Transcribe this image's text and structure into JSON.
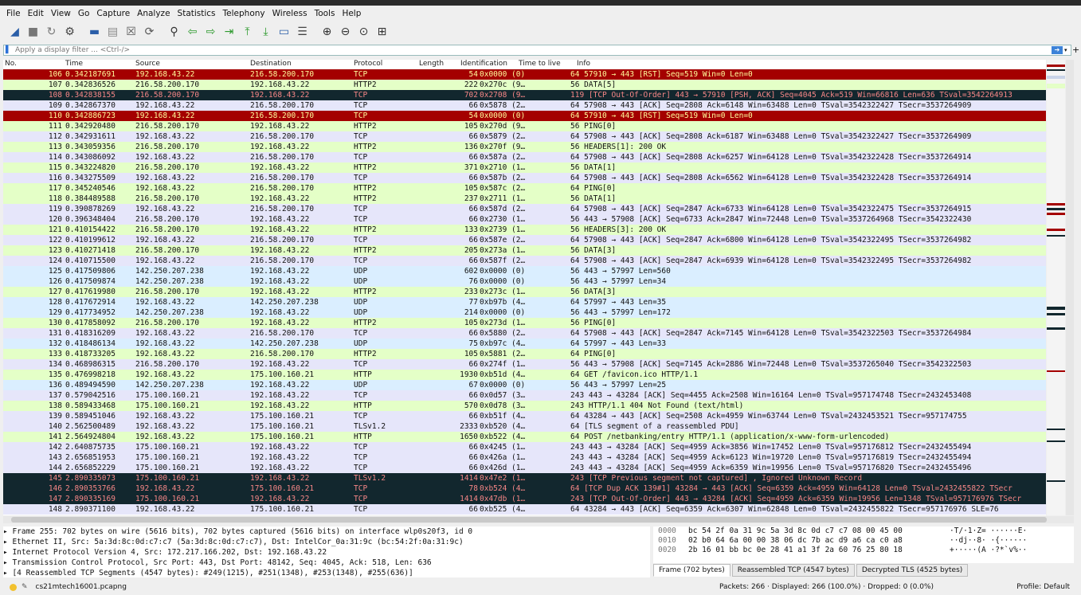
{
  "menu": [
    "File",
    "Edit",
    "View",
    "Go",
    "Capture",
    "Analyze",
    "Statistics",
    "Telephony",
    "Wireless",
    "Tools",
    "Help"
  ],
  "toolbar_icons": [
    "shark-fin-start-icon",
    "stop-icon",
    "restart-icon",
    "options-icon",
    "open-icon",
    "save-icon",
    "close-file-icon",
    "reload-icon",
    "find-icon",
    "back-icon",
    "forward-icon",
    "go-to-packet-icon",
    "first-packet-icon",
    "last-packet-icon",
    "autoscroll-icon",
    "colorize-icon",
    "zoom-in-icon",
    "zoom-out-icon",
    "normal-size-icon",
    "resize-columns-icon"
  ],
  "filter": {
    "placeholder": "Apply a display filter ... <Ctrl-/>"
  },
  "columns": [
    "No.",
    "Time",
    "Source",
    "Destination",
    "Protocol",
    "Length",
    "Identification",
    "Time to live",
    "Info"
  ],
  "colors": {
    "tcp": "#e6e6fa",
    "http": "#e4ffc7",
    "udp": "#daeeff",
    "rst": "#a40000",
    "bad": "#12272e",
    "selected": "#1f4f8f"
  },
  "packets": [
    {
      "no": "106",
      "time": "0.342187691",
      "src": "192.168.43.22",
      "dst": "216.58.200.170",
      "proto": "TCP",
      "len": "54",
      "id": "0x0000 (0)",
      "ttl": "",
      "info": "64 57910 → 443 [RST] Seq=519 Win=0 Len=0",
      "cls": "rst"
    },
    {
      "no": "107",
      "time": "0.342836526",
      "src": "216.58.200.170",
      "dst": "192.168.43.22",
      "proto": "HTTP2",
      "len": "222",
      "id": "0x270c (9…",
      "ttl": "",
      "info": "56 DATA[5]",
      "cls": "http"
    },
    {
      "no": "108",
      "time": "0.342838155",
      "src": "216.58.200.170",
      "dst": "192.168.43.22",
      "proto": "TCP",
      "len": "702",
      "id": "0x2708 (9…",
      "ttl": "",
      "info": "119 [TCP Out-Of-Order] 443 → 57910 [PSH, ACK] Seq=4045 Ack=519 Win=66816 Len=636 TSval=3542264913",
      "cls": "bad"
    },
    {
      "no": "109",
      "time": "0.342867370",
      "src": "192.168.43.22",
      "dst": "216.58.200.170",
      "proto": "TCP",
      "len": "66",
      "id": "0x5878 (2…",
      "ttl": "",
      "info": "64 57908 → 443 [ACK] Seq=2808 Ack=6148 Win=63488 Len=0 TSval=3542322427 TSecr=3537264909",
      "cls": "tcp"
    },
    {
      "no": "110",
      "time": "0.342886723",
      "src": "192.168.43.22",
      "dst": "216.58.200.170",
      "proto": "TCP",
      "len": "54",
      "id": "0x0000 (0)",
      "ttl": "",
      "info": "64 57910 → 443 [RST] Seq=519 Win=0 Len=0",
      "cls": "rst"
    },
    {
      "no": "111",
      "time": "0.342920480",
      "src": "216.58.200.170",
      "dst": "192.168.43.22",
      "proto": "HTTP2",
      "len": "105",
      "id": "0x270d (9…",
      "ttl": "",
      "info": "56 PING[0]",
      "cls": "http"
    },
    {
      "no": "112",
      "time": "0.342931611",
      "src": "192.168.43.22",
      "dst": "216.58.200.170",
      "proto": "TCP",
      "len": "66",
      "id": "0x5879 (2…",
      "ttl": "",
      "info": "64 57908 → 443 [ACK] Seq=2808 Ack=6187 Win=63488 Len=0 TSval=3542322427 TSecr=3537264909",
      "cls": "tcp"
    },
    {
      "no": "113",
      "time": "0.343059356",
      "src": "216.58.200.170",
      "dst": "192.168.43.22",
      "proto": "HTTP2",
      "len": "136",
      "id": "0x270f (9…",
      "ttl": "",
      "info": "56 HEADERS[1]: 200 OK",
      "cls": "http"
    },
    {
      "no": "114",
      "time": "0.343086092",
      "src": "192.168.43.22",
      "dst": "216.58.200.170",
      "proto": "TCP",
      "len": "66",
      "id": "0x587a (2…",
      "ttl": "",
      "info": "64 57908 → 443 [ACK] Seq=2808 Ack=6257 Win=64128 Len=0 TSval=3542322428 TSecr=3537264914",
      "cls": "tcp"
    },
    {
      "no": "115",
      "time": "0.343224820",
      "src": "216.58.200.170",
      "dst": "192.168.43.22",
      "proto": "HTTP2",
      "len": "371",
      "id": "0x2710 (1…",
      "ttl": "",
      "info": "56 DATA[1]",
      "cls": "http"
    },
    {
      "no": "116",
      "time": "0.343275509",
      "src": "192.168.43.22",
      "dst": "216.58.200.170",
      "proto": "TCP",
      "len": "66",
      "id": "0x587b (2…",
      "ttl": "",
      "info": "64 57908 → 443 [ACK] Seq=2808 Ack=6562 Win=64128 Len=0 TSval=3542322428 TSecr=3537264914",
      "cls": "tcp"
    },
    {
      "no": "117",
      "time": "0.345240546",
      "src": "192.168.43.22",
      "dst": "216.58.200.170",
      "proto": "HTTP2",
      "len": "105",
      "id": "0x587c (2…",
      "ttl": "",
      "info": "64 PING[0]",
      "cls": "http"
    },
    {
      "no": "118",
      "time": "0.384489588",
      "src": "216.58.200.170",
      "dst": "192.168.43.22",
      "proto": "HTTP2",
      "len": "237",
      "id": "0x2711 (1…",
      "ttl": "",
      "info": "56 DATA[1]",
      "cls": "http"
    },
    {
      "no": "119",
      "time": "0.390878269",
      "src": "192.168.43.22",
      "dst": "216.58.200.170",
      "proto": "TCP",
      "len": "66",
      "id": "0x587d (2…",
      "ttl": "",
      "info": "64 57908 → 443 [ACK] Seq=2847 Ack=6733 Win=64128 Len=0 TSval=3542322475 TSecr=3537264915",
      "cls": "tcp"
    },
    {
      "no": "120",
      "time": "0.396348404",
      "src": "216.58.200.170",
      "dst": "192.168.43.22",
      "proto": "TCP",
      "len": "66",
      "id": "0x2730 (1…",
      "ttl": "",
      "info": "56 443 → 57908 [ACK] Seq=6733 Ack=2847 Win=72448 Len=0 TSval=3537264968 TSecr=3542322430",
      "cls": "tcp"
    },
    {
      "no": "121",
      "time": "0.410154422",
      "src": "216.58.200.170",
      "dst": "192.168.43.22",
      "proto": "HTTP2",
      "len": "133",
      "id": "0x2739 (1…",
      "ttl": "",
      "info": "56 HEADERS[3]: 200 OK",
      "cls": "http"
    },
    {
      "no": "122",
      "time": "0.410199612",
      "src": "192.168.43.22",
      "dst": "216.58.200.170",
      "proto": "TCP",
      "len": "66",
      "id": "0x587e (2…",
      "ttl": "",
      "info": "64 57908 → 443 [ACK] Seq=2847 Ack=6800 Win=64128 Len=0 TSval=3542322495 TSecr=3537264982",
      "cls": "tcp"
    },
    {
      "no": "123",
      "time": "0.410271418",
      "src": "216.58.200.170",
      "dst": "192.168.43.22",
      "proto": "HTTP2",
      "len": "205",
      "id": "0x273a (1…",
      "ttl": "",
      "info": "56 DATA[3]",
      "cls": "http"
    },
    {
      "no": "124",
      "time": "0.410715500",
      "src": "192.168.43.22",
      "dst": "216.58.200.170",
      "proto": "TCP",
      "len": "66",
      "id": "0x587f (2…",
      "ttl": "",
      "info": "64 57908 → 443 [ACK] Seq=2847 Ack=6939 Win=64128 Len=0 TSval=3542322495 TSecr=3537264982",
      "cls": "tcp"
    },
    {
      "no": "125",
      "time": "0.417509806",
      "src": "142.250.207.238",
      "dst": "192.168.43.22",
      "proto": "UDP",
      "len": "602",
      "id": "0x0000 (0)",
      "ttl": "",
      "info": "56 443 → 57997 Len=560",
      "cls": "udp"
    },
    {
      "no": "126",
      "time": "0.417509874",
      "src": "142.250.207.238",
      "dst": "192.168.43.22",
      "proto": "UDP",
      "len": "76",
      "id": "0x0000 (0)",
      "ttl": "",
      "info": "56 443 → 57997 Len=34",
      "cls": "udp"
    },
    {
      "no": "127",
      "time": "0.417619980",
      "src": "216.58.200.170",
      "dst": "192.168.43.22",
      "proto": "HTTP2",
      "len": "233",
      "id": "0x273c (1…",
      "ttl": "",
      "info": "56 DATA[3]",
      "cls": "http"
    },
    {
      "no": "128",
      "time": "0.417672914",
      "src": "192.168.43.22",
      "dst": "142.250.207.238",
      "proto": "UDP",
      "len": "77",
      "id": "0xb97b (4…",
      "ttl": "",
      "info": "64 57997 → 443 Len=35",
      "cls": "udp"
    },
    {
      "no": "129",
      "time": "0.417734952",
      "src": "142.250.207.238",
      "dst": "192.168.43.22",
      "proto": "UDP",
      "len": "214",
      "id": "0x0000 (0)",
      "ttl": "",
      "info": "56 443 → 57997 Len=172",
      "cls": "udp"
    },
    {
      "no": "130",
      "time": "0.417858092",
      "src": "216.58.200.170",
      "dst": "192.168.43.22",
      "proto": "HTTP2",
      "len": "105",
      "id": "0x273d (1…",
      "ttl": "",
      "info": "56 PING[0]",
      "cls": "http"
    },
    {
      "no": "131",
      "time": "0.418316209",
      "src": "192.168.43.22",
      "dst": "216.58.200.170",
      "proto": "TCP",
      "len": "66",
      "id": "0x5880 (2…",
      "ttl": "",
      "info": "64 57908 → 443 [ACK] Seq=2847 Ack=7145 Win=64128 Len=0 TSval=3542322503 TSecr=3537264984",
      "cls": "tcp"
    },
    {
      "no": "132",
      "time": "0.418486134",
      "src": "192.168.43.22",
      "dst": "142.250.207.238",
      "proto": "UDP",
      "len": "75",
      "id": "0xb97c (4…",
      "ttl": "",
      "info": "64 57997 → 443 Len=33",
      "cls": "udp"
    },
    {
      "no": "133",
      "time": "0.418733205",
      "src": "192.168.43.22",
      "dst": "216.58.200.170",
      "proto": "HTTP2",
      "len": "105",
      "id": "0x5881 (2…",
      "ttl": "",
      "info": "64 PING[0]",
      "cls": "http"
    },
    {
      "no": "134",
      "time": "0.468986315",
      "src": "216.58.200.170",
      "dst": "192.168.43.22",
      "proto": "TCP",
      "len": "66",
      "id": "0x274f (1…",
      "ttl": "",
      "info": "56 443 → 57908 [ACK] Seq=7145 Ack=2886 Win=72448 Len=0 TSval=3537265040 TSecr=3542322503",
      "cls": "tcp"
    },
    {
      "no": "135",
      "time": "0.476998218",
      "src": "192.168.43.22",
      "dst": "175.100.160.21",
      "proto": "HTTP",
      "len": "1930",
      "id": "0xb51d (4…",
      "ttl": "",
      "info": "64 GET /favicon.ico HTTP/1.1",
      "cls": "http"
    },
    {
      "no": "136",
      "time": "0.489494590",
      "src": "142.250.207.238",
      "dst": "192.168.43.22",
      "proto": "UDP",
      "len": "67",
      "id": "0x0000 (0)",
      "ttl": "",
      "info": "56 443 → 57997 Len=25",
      "cls": "udp"
    },
    {
      "no": "137",
      "time": "0.579042516",
      "src": "175.100.160.21",
      "dst": "192.168.43.22",
      "proto": "TCP",
      "len": "66",
      "id": "0x0d57 (3…",
      "ttl": "",
      "info": "243 443 → 43284 [ACK] Seq=4455 Ack=2508 Win=16164 Len=0 TSval=957174748 TSecr=2432453408",
      "cls": "tcp"
    },
    {
      "no": "138",
      "time": "0.589433468",
      "src": "175.100.160.21",
      "dst": "192.168.43.22",
      "proto": "HTTP",
      "len": "570",
      "id": "0x0d78 (3…",
      "ttl": "",
      "info": "243 HTTP/1.1 404 Not Found  (text/html)",
      "cls": "http"
    },
    {
      "no": "139",
      "time": "0.589451046",
      "src": "192.168.43.22",
      "dst": "175.100.160.21",
      "proto": "TCP",
      "len": "66",
      "id": "0xb51f (4…",
      "ttl": "",
      "info": "64 43284 → 443 [ACK] Seq=2508 Ack=4959 Win=63744 Len=0 TSval=2432453521 TSecr=957174755",
      "cls": "tcp"
    },
    {
      "no": "140",
      "time": "2.562500489",
      "src": "192.168.43.22",
      "dst": "175.100.160.21",
      "proto": "TLSv1.2",
      "len": "2333",
      "id": "0xb520 (4…",
      "ttl": "",
      "info": "64 [TLS segment of a reassembled PDU]",
      "cls": "tcp"
    },
    {
      "no": "141",
      "time": "2.564924804",
      "src": "192.168.43.22",
      "dst": "175.100.160.21",
      "proto": "HTTP",
      "len": "1650",
      "id": "0xb522 (4…",
      "ttl": "",
      "info": "64 POST /netbanking/entry HTTP/1.1  (application/x-www-form-urlencoded)",
      "cls": "http"
    },
    {
      "no": "142",
      "time": "2.640875735",
      "src": "175.100.160.21",
      "dst": "192.168.43.22",
      "proto": "TCP",
      "len": "66",
      "id": "0x4245 (1…",
      "ttl": "",
      "info": "243 443 → 43284 [ACK] Seq=4959 Ack=3856 Win=17452 Len=0 TSval=957176812 TSecr=2432455494",
      "cls": "tcp"
    },
    {
      "no": "143",
      "time": "2.656851953",
      "src": "175.100.160.21",
      "dst": "192.168.43.22",
      "proto": "TCP",
      "len": "66",
      "id": "0x426a (1…",
      "ttl": "",
      "info": "243 443 → 43284 [ACK] Seq=4959 Ack=6123 Win=19720 Len=0 TSval=957176819 TSecr=2432455494",
      "cls": "tcp"
    },
    {
      "no": "144",
      "time": "2.656852229",
      "src": "175.100.160.21",
      "dst": "192.168.43.22",
      "proto": "TCP",
      "len": "66",
      "id": "0x426d (1…",
      "ttl": "",
      "info": "243 443 → 43284 [ACK] Seq=4959 Ack=6359 Win=19956 Len=0 TSval=957176820 TSecr=2432455496",
      "cls": "tcp"
    },
    {
      "no": "145",
      "time": "2.890335073",
      "src": "175.100.160.21",
      "dst": "192.168.43.22",
      "proto": "TLSv1.2",
      "len": "1414",
      "id": "0x47e2 (1…",
      "ttl": "",
      "info": "243 [TCP Previous segment not captured] , Ignored Unknown Record",
      "cls": "bad"
    },
    {
      "no": "146",
      "time": "2.890353766",
      "src": "192.168.43.22",
      "dst": "175.100.160.21",
      "proto": "TCP",
      "len": "78",
      "id": "0xb524 (4…",
      "ttl": "",
      "info": "64 [TCP Dup ACK 139#1] 43284 → 443 [ACK] Seq=6359 Ack=4959 Win=64128 Len=0 TSval=2432455822 TSecr",
      "cls": "bad"
    },
    {
      "no": "147",
      "time": "2.890335169",
      "src": "175.100.160.21",
      "dst": "192.168.43.22",
      "proto": "TCP",
      "len": "1414",
      "id": "0x47db (1…",
      "ttl": "",
      "info": "243 [TCP Out-Of-Order] 443 → 43284 [ACK] Seq=4959 Ack=6359 Win=19956 Len=1348 TSval=957176976 TSecr",
      "cls": "bad"
    },
    {
      "no": "148",
      "time": "2.890371100",
      "src": "192.168.43.22",
      "dst": "175.100.160.21",
      "proto": "TCP",
      "len": "66",
      "id": "0xb525 (4…",
      "ttl": "",
      "info": "64 43284 → 443 [ACK] Seq=6359 Ack=6307 Win=62848 Len=0 TSval=2432455822 TSecr=957176976 SLE=76",
      "cls": "tcp"
    }
  ],
  "details": [
    "Frame 255: 702 bytes on wire (5616 bits), 702 bytes captured (5616 bits) on interface wlp0s20f3, id 0",
    "Ethernet II, Src: 5a:3d:8c:0d:c7:c7 (5a:3d:8c:0d:c7:c7), Dst: IntelCor_0a:31:9c (bc:54:2f:0a:31:9c)",
    "Internet Protocol Version 4, Src: 172.217.166.202, Dst: 192.168.43.22",
    "Transmission Control Protocol, Src Port: 443, Dst Port: 48142, Seq: 4045, Ack: 518, Len: 636",
    "[4 Reassembled TCP Segments (4547 bytes): #249(1215), #251(1348), #253(1348), #255(636)]"
  ],
  "bytes": [
    {
      "off": "0000",
      "hex": "bc 54 2f 0a 31 9c 5a 3d  8c 0d c7 c7 08 00 45 00",
      "ascii": "·T/·1·Z= ······E·"
    },
    {
      "off": "0010",
      "hex": "02 b0 64 6a 00 00 38 06  dc 7b ac d9 a6 ca c0 a8",
      "ascii": "··dj··8· ·{······"
    },
    {
      "off": "0020",
      "hex": "2b 16 01 bb bc 0e 28 41  a1 3f 2a 60 76 25 80 18",
      "ascii": "+·····(A ·?*`v%··"
    }
  ],
  "byte_tabs": [
    "Frame (702 bytes)",
    "Reassembled TCP (4547 bytes)",
    "Decrypted TLS (4525 bytes)"
  ],
  "status": {
    "file": "cs21mtech16001.pcapng",
    "packets": "Packets: 266 · Displayed: 266 (100.0%) · Dropped: 0 (0.0%)",
    "profile": "Profile: Default"
  }
}
